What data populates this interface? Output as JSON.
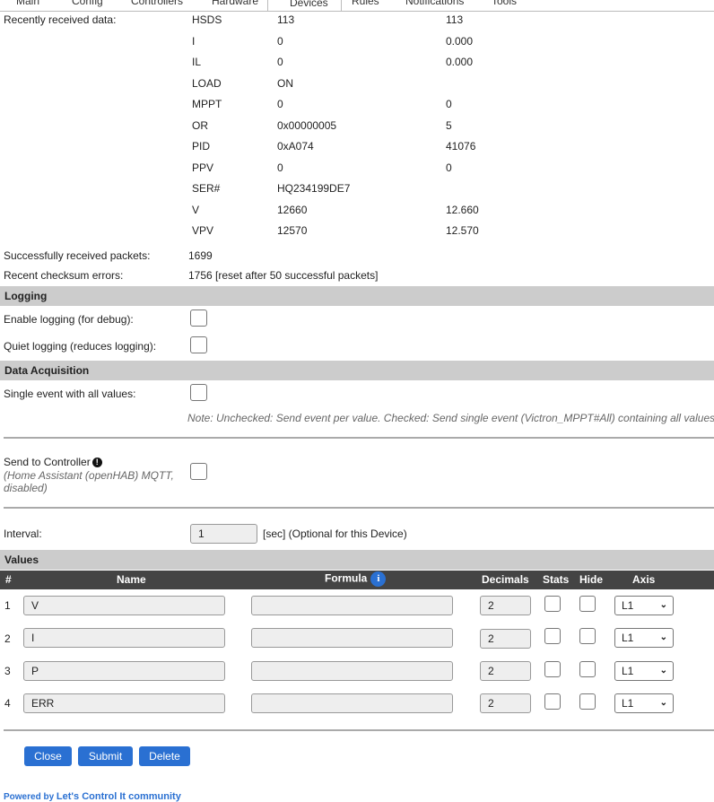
{
  "tabs": [
    {
      "label": "Main",
      "icon": "home-icon",
      "active": false
    },
    {
      "label": "Config",
      "icon": "gear-icon",
      "active": false
    },
    {
      "label": "Controllers",
      "icon": "chat-icon",
      "active": false
    },
    {
      "label": "Hardware",
      "icon": "pin-icon",
      "active": false
    },
    {
      "label": "Devices",
      "icon": "plug-icon",
      "active": true
    },
    {
      "label": "Rules",
      "icon": "book-icon",
      "active": false
    },
    {
      "label": "Notifications",
      "icon": "envelope-icon",
      "active": false
    },
    {
      "label": "Tools",
      "icon": "wrench-icon",
      "active": false
    }
  ],
  "received": {
    "label": "Recently received data:",
    "rows": [
      {
        "key": "HSDS",
        "raw": "113",
        "value": "113"
      },
      {
        "key": "I",
        "raw": "0",
        "value": "0.000"
      },
      {
        "key": "IL",
        "raw": "0",
        "value": "0.000"
      },
      {
        "key": "LOAD",
        "raw": "ON",
        "value": ""
      },
      {
        "key": "MPPT",
        "raw": "0",
        "value": "0"
      },
      {
        "key": "OR",
        "raw": "0x00000005",
        "value": "5"
      },
      {
        "key": "PID",
        "raw": "0xA074",
        "value": "41076"
      },
      {
        "key": "PPV",
        "raw": "0",
        "value": "0"
      },
      {
        "key": "SER#",
        "raw": "HQ234199DE7",
        "value": ""
      },
      {
        "key": "V",
        "raw": "12660",
        "value": "12.660"
      },
      {
        "key": "VPV",
        "raw": "12570",
        "value": "12.570"
      }
    ]
  },
  "stats": {
    "packets_label": "Successfully received packets:",
    "packets_value": "1699",
    "checksum_label": "Recent checksum errors:",
    "checksum_value": "1756 [reset after 50 successful packets]"
  },
  "logging": {
    "header": "Logging",
    "enable_label": "Enable logging (for debug):",
    "quiet_label": "Quiet logging (reduces logging):"
  },
  "acquisition": {
    "header": "Data Acquisition",
    "single_label": "Single event with all values:",
    "note": "Note: Unchecked: Send event per value. Checked: Send single event (Victron_MPPT#All) containing all values"
  },
  "controller": {
    "label": "Send to Controller",
    "sublabel_1": "(Home Assistant (openHAB) MQTT,",
    "sublabel_2": "disabled)"
  },
  "interval": {
    "label": "Interval:",
    "value": "1",
    "unit": "[sec] (Optional for this Device)"
  },
  "values": {
    "header": "Values",
    "columns": {
      "num": "#",
      "name": "Name",
      "formula": "Formula",
      "decimals": "Decimals",
      "stats": "Stats",
      "hide": "Hide",
      "axis": "Axis"
    },
    "rows": [
      {
        "num": "1",
        "name": "V",
        "formula": "",
        "decimals": "2",
        "axis": "L1"
      },
      {
        "num": "2",
        "name": "I",
        "formula": "",
        "decimals": "2",
        "axis": "L1"
      },
      {
        "num": "3",
        "name": "P",
        "formula": "",
        "decimals": "2",
        "axis": "L1"
      },
      {
        "num": "4",
        "name": "ERR",
        "formula": "",
        "decimals": "2",
        "axis": "L1"
      }
    ]
  },
  "buttons": {
    "close": "Close",
    "submit": "Submit",
    "delete": "Delete"
  },
  "footer": {
    "prefix": "Powered by",
    "link": "Let's Control It community"
  },
  "colors": {
    "accent": "#2a70d2",
    "section_bg": "#cccccc",
    "table_header_bg": "#444444"
  }
}
